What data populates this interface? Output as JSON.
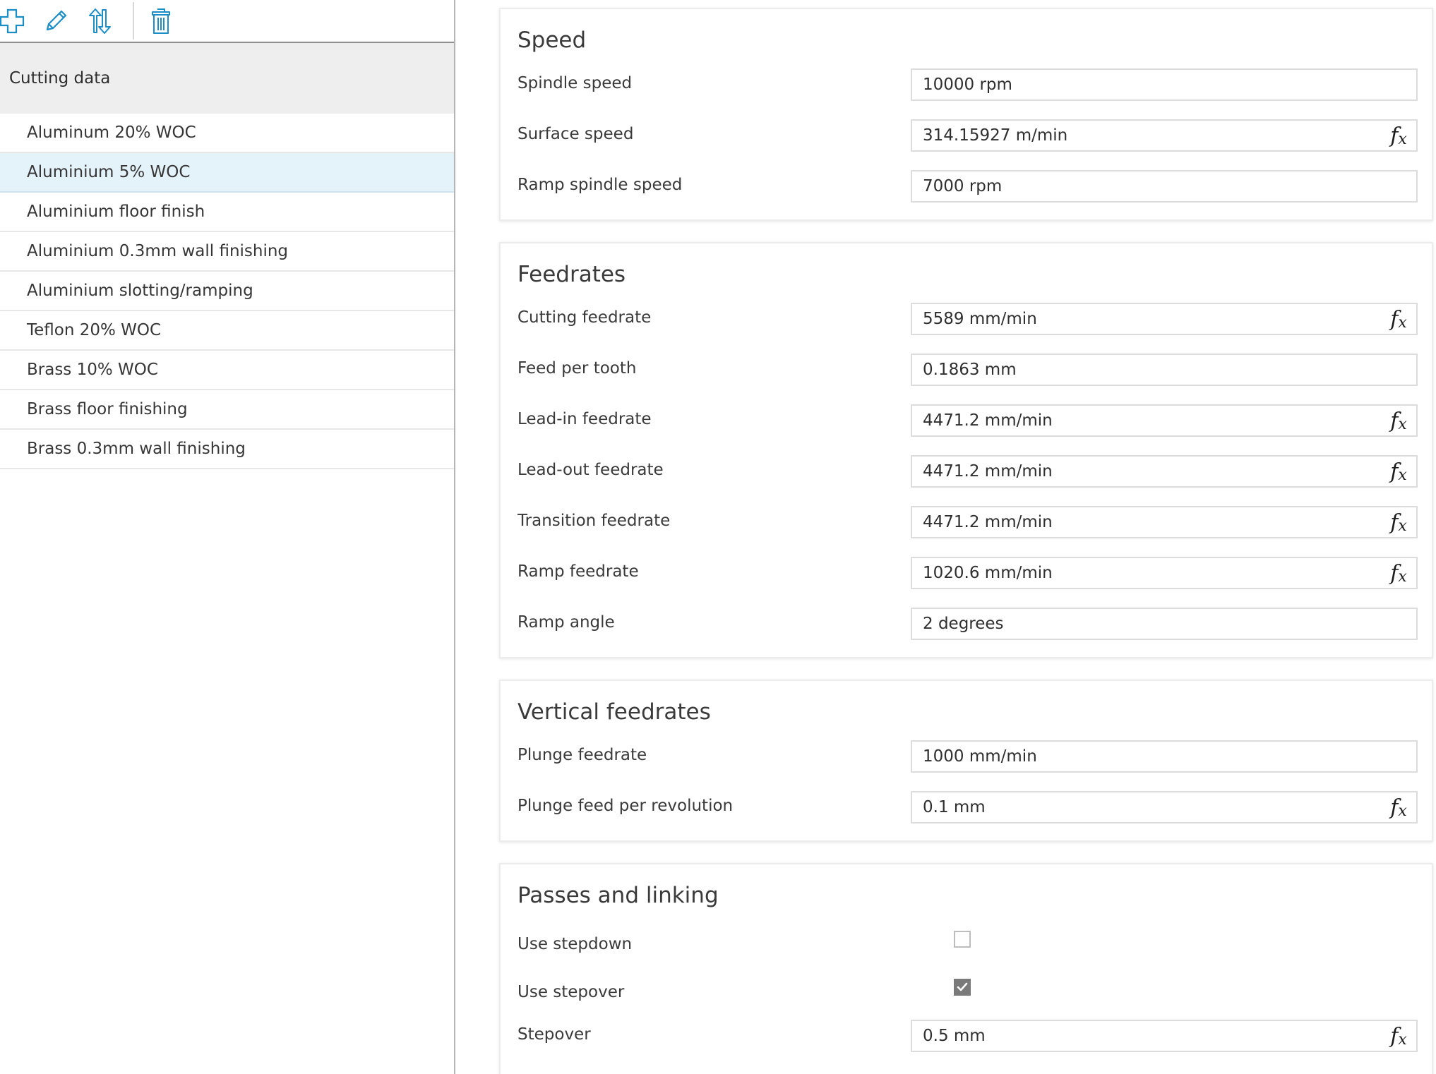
{
  "toolbar": {
    "add": "add-icon",
    "edit": "pencil-icon",
    "sort": "sort-arrows-icon",
    "delete": "trash-icon",
    "accent_color": "#1b8ec8"
  },
  "list": {
    "header": "Cutting data",
    "items": [
      "Aluminum 20% WOC",
      "Aluminium 5% WOC",
      "Aluminium floor finish",
      "Aluminium 0.3mm wall finishing",
      "Aluminium slotting/ramping",
      "Teflon 20% WOC",
      "Brass 10% WOC",
      "Brass floor finishing",
      "Brass 0.3mm wall finishing"
    ],
    "selected_index": 1
  },
  "speed": {
    "title": "Speed",
    "spindle_speed": {
      "label": "Spindle speed",
      "value": "10000 rpm"
    },
    "surface_speed": {
      "label": "Surface speed",
      "value": "314.15927 m/min"
    },
    "ramp_spindle_speed": {
      "label": "Ramp spindle speed",
      "value": "7000 rpm"
    }
  },
  "feedrates": {
    "title": "Feedrates",
    "cutting_feedrate": {
      "label": "Cutting feedrate",
      "value": "5589 mm/min"
    },
    "feed_per_tooth": {
      "label": "Feed per tooth",
      "value": "0.1863 mm"
    },
    "lead_in_feedrate": {
      "label": "Lead-in feedrate",
      "value": "4471.2 mm/min"
    },
    "lead_out_feedrate": {
      "label": "Lead-out feedrate",
      "value": "4471.2 mm/min"
    },
    "transition_feedrate": {
      "label": "Transition feedrate",
      "value": "4471.2 mm/min"
    },
    "ramp_feedrate": {
      "label": "Ramp feedrate",
      "value": "1020.6 mm/min"
    },
    "ramp_angle": {
      "label": "Ramp angle",
      "value": "2 degrees"
    }
  },
  "vertical": {
    "title": "Vertical feedrates",
    "plunge_feedrate": {
      "label": "Plunge feedrate",
      "value": "1000 mm/min"
    },
    "plunge_feed_per_rev": {
      "label": "Plunge feed per revolution",
      "value": "0.1 mm"
    }
  },
  "passes": {
    "title": "Passes and linking",
    "use_stepdown": {
      "label": "Use stepdown",
      "checked": false
    },
    "use_stepover": {
      "label": "Use stepover",
      "checked": true
    },
    "stepover": {
      "label": "Stepover",
      "value": "0.5 mm"
    }
  },
  "fx": {
    "main": "f",
    "sub": "x"
  }
}
